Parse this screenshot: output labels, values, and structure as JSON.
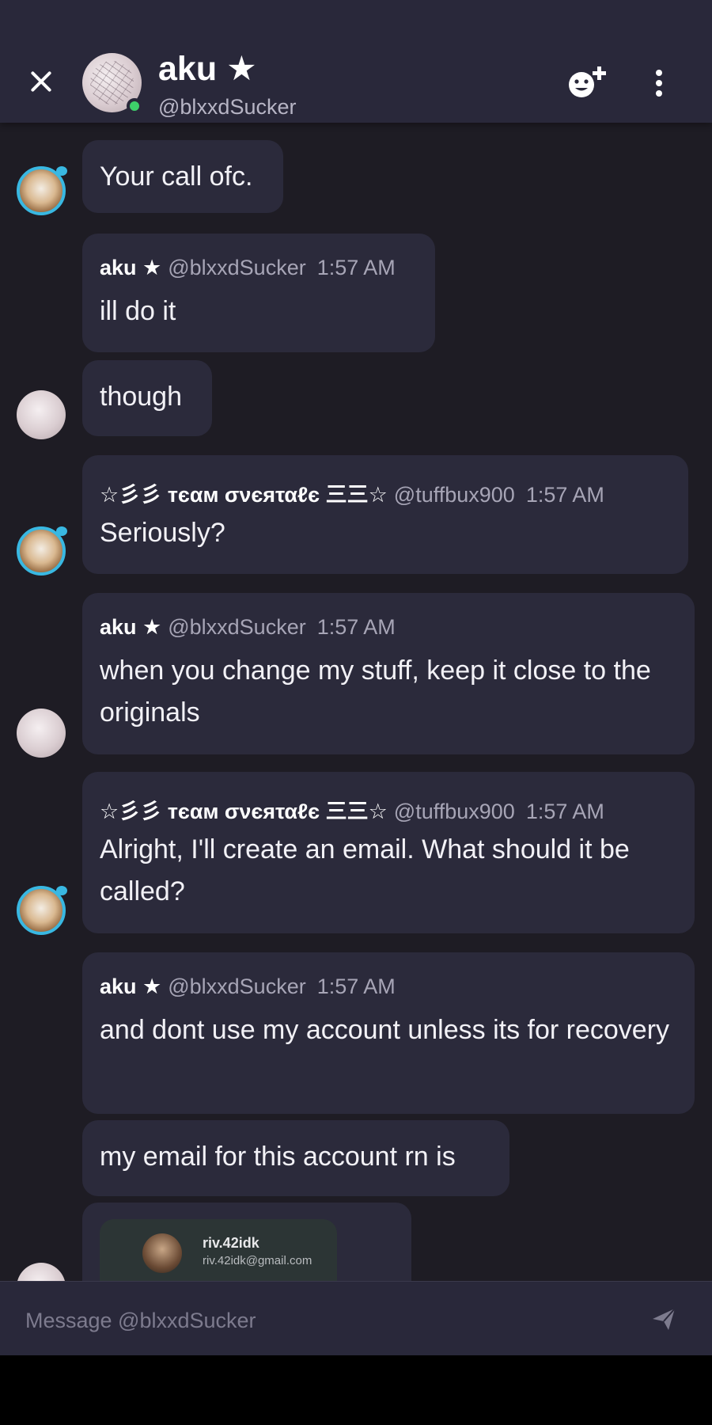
{
  "header": {
    "name": "aku",
    "name_star": "★",
    "handle": "@blxxdSucker"
  },
  "messages": [
    {
      "text": "Your call ofc."
    },
    {
      "author": "aku ★",
      "handle": "@blxxdSucker",
      "time": "1:57 AM",
      "text": "ill do it"
    },
    {
      "text": "though"
    },
    {
      "author": "☆彡彡 ᴛєαм σνєяταℓє 三三☆",
      "handle": "@tuffbux900",
      "time": "1:57 AM",
      "text": "Seriously?"
    },
    {
      "author": "aku ★",
      "handle": "@blxxdSucker",
      "time": "1:57 AM",
      "text": "when you change my stuff, keep it close to the originals"
    },
    {
      "author": "☆彡彡 ᴛєαм σνєяταℓє 三三☆",
      "handle": "@tuffbux900",
      "time": "1:57 AM",
      "text": "Alright, I'll create an email. What should it be called?"
    },
    {
      "author": "aku ★",
      "handle": "@blxxdSucker",
      "time": "1:57 AM",
      "text": "and dont use my account unless its for recovery"
    },
    {
      "text": "my email for this account rn is"
    }
  ],
  "account_card": {
    "name": "riv.42idk",
    "email": "riv.42idk@gmail.com"
  },
  "composer": {
    "placeholder": "Message @blxxdSucker"
  },
  "icons": {
    "close": "close-icon",
    "add_friend": "add-friend-icon",
    "more": "more-vertical-icon",
    "send": "send-icon"
  },
  "colors": {
    "background": "#1e1c24",
    "bubble": "#2b2a3b",
    "header": "#29283a",
    "online": "#3ecf6a",
    "avatar_ring": "#39b8e2"
  }
}
